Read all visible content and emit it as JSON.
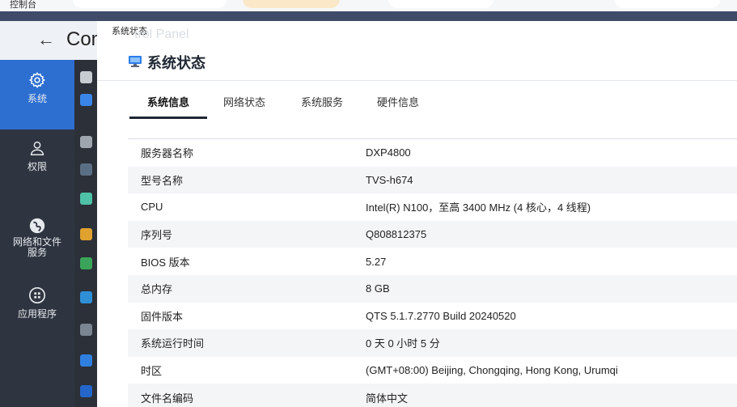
{
  "taskbar": {
    "label": "控制台"
  },
  "control_panel": {
    "title": "Con",
    "back": "←",
    "faint_subtitle": "trol Panel"
  },
  "left_nav": {
    "items": [
      {
        "label": "系统",
        "icon": "gear-icon",
        "active": true
      },
      {
        "label": "权限",
        "icon": "user-icon",
        "active": false
      },
      {
        "label_line1": "网络和文件",
        "label_line2": "服务",
        "icon": "globe-icon",
        "active": false
      },
      {
        "label": "应用程序",
        "icon": "apps-grid-icon",
        "active": false
      }
    ]
  },
  "window": {
    "caption": "系统状态",
    "title": "系统状态",
    "tabs": [
      {
        "label": "系统信息",
        "active": true
      },
      {
        "label": "网络状态",
        "active": false
      },
      {
        "label": "系统服务",
        "active": false
      },
      {
        "label": "硬件信息",
        "active": false
      }
    ],
    "rows": [
      {
        "label": "服务器名称",
        "value": "DXP4800"
      },
      {
        "label": "型号名称",
        "value": "TVS-h674"
      },
      {
        "label": "CPU",
        "value": "Intel(R) N100，至高 3400 MHz (4 核心，4 线程)"
      },
      {
        "label": "序列号",
        "value": "Q808812375"
      },
      {
        "label": "BIOS 版本",
        "value": "5.27"
      },
      {
        "label": "总内存",
        "value": "8 GB"
      },
      {
        "label": "固件版本",
        "value": "QTS 5.1.7.2770 Build 20240520"
      },
      {
        "label": "系统运行时间",
        "value": "0 天 0 小时 5 分"
      },
      {
        "label": "时区",
        "value": "(GMT+08:00) Beijing, Chongqing, Hong Kong, Urumqi"
      },
      {
        "label": "文件名编码",
        "value": "简体中文"
      }
    ]
  },
  "colors": {
    "nav_bg": "#2f3540",
    "nav_active": "#2d6fd1",
    "band": "#3f4b68",
    "accent_monitor": "#2b7de9"
  }
}
